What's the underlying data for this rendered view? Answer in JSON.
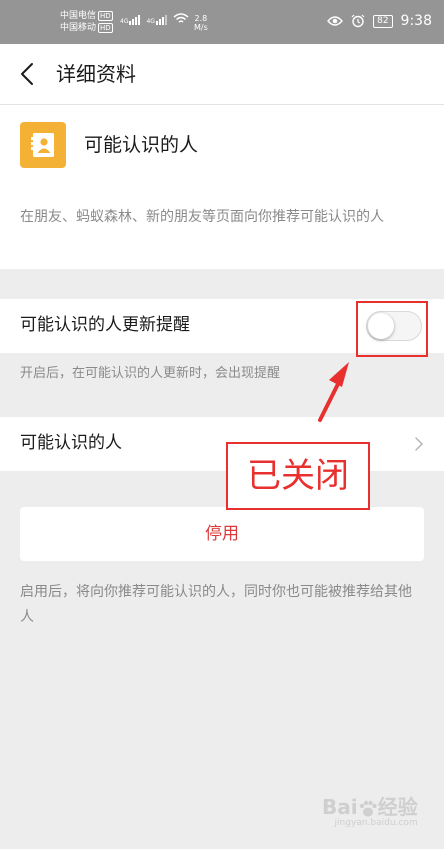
{
  "status_bar": {
    "carrier_1": "中国电信",
    "carrier_2": "中国移动",
    "hd_badge": "HD",
    "net_type_1": "4G",
    "net_type_2": "4G",
    "net_speed": "2.8",
    "net_unit": "M/s",
    "battery": "82",
    "time": "9:38",
    "icons": [
      "signal-icon",
      "wifi-icon",
      "eye-icon",
      "alarm-icon",
      "battery-icon"
    ]
  },
  "nav": {
    "title": "详细资料",
    "back_icon": "chevron-left-icon"
  },
  "intro": {
    "title": "可能认识的人",
    "icon": "contact-card-icon",
    "description": "在朋友、蚂蚁森林、新的朋友等页面向你推荐可能认识的人"
  },
  "notify_setting": {
    "label": "可能认识的人更新提醒",
    "enabled": false,
    "hint": "开启后，在可能认识的人更新时，会出现提醒"
  },
  "people_entry": {
    "label": "可能认识的人",
    "chevron": "chevron-right-icon"
  },
  "disable": {
    "label": "停用",
    "hint": "启用后，将向你推荐可能认识的人，同时你也可能被推荐给其他人"
  },
  "annotation": {
    "text": "已关闭"
  },
  "watermark": {
    "text": "Bai",
    "text2": "经验",
    "url": "jingyan.baidu.com"
  },
  "colors": {
    "accent_red": "#e8312f",
    "disable_text": "#d93b3b",
    "icon_bg": "#f3b236",
    "page_bg": "#ededed"
  }
}
